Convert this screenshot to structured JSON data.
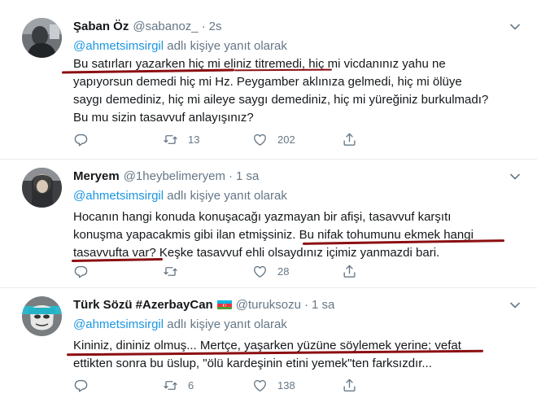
{
  "tweets": [
    {
      "name": "Şaban Öz",
      "handle": "@sabanoz_",
      "time": "2s",
      "reply_prefix": "@ahmetsimsirgil",
      "reply_suffix": " adlı kişiye yanıt olarak",
      "lines": [
        "Bu satırları yazarken hiç mi eliniz titremedi, hiç mi vicdanınız yahu ne",
        "yapıyorsun demedi hiç mi Hz. Peygamber aklınıza gelmedi, hiç mi ölüye",
        "saygı demediniz, hiç mi aileye saygı demediniz, hiç mi yüreğiniz burkulmadı?",
        "Bu mu sizin tasavvuf anlayışınız?"
      ],
      "retweets": "13",
      "likes": "202",
      "reply_count": ""
    },
    {
      "name": "Meryem",
      "handle": "@1heybelimeryem",
      "time": "1 sa",
      "reply_prefix": "@ahmetsimsirgil",
      "reply_suffix": " adlı kişiye yanıt olarak",
      "lines": [
        "Hocanın hangi konuda konuşacağı yazmayan bir afişi, tasavvuf karşıtı",
        "konuşma yapacakmis gibi ilan etmişsiniz. Bu nifak tohumunu ekmek hangi",
        "tasavvufta var? Keşke tasavvuf ehli olsaydınız içimiz yanmazdi bari."
      ],
      "retweets": "",
      "likes": "28",
      "reply_count": ""
    },
    {
      "name": "Türk Sözü #AzerbayCan",
      "handle": "@turuksozu",
      "time": "1 sa",
      "reply_prefix": "@ahmetsimsirgil",
      "reply_suffix": " adlı kişiye yanıt olarak",
      "lines": [
        "Kininiz, dininiz olmuş... Mertçe, yaşarken yüzüne söylemek yerine; vefat",
        "ettikten sonra bu üslup, \"ölü kardeşinin etini yemek\"ten farksızdır..."
      ],
      "retweets": "6",
      "likes": "138",
      "reply_count": ""
    }
  ],
  "colors": {
    "link": "#1b95e0",
    "secondary": "#657786",
    "text": "#14171a",
    "underline": "#8b0e12",
    "divider": "#e6ecf0"
  },
  "icons": [
    "reply-icon",
    "retweet-icon",
    "like-icon",
    "share-icon",
    "chevron-down-icon",
    "azerbaijan-flag-icon"
  ]
}
